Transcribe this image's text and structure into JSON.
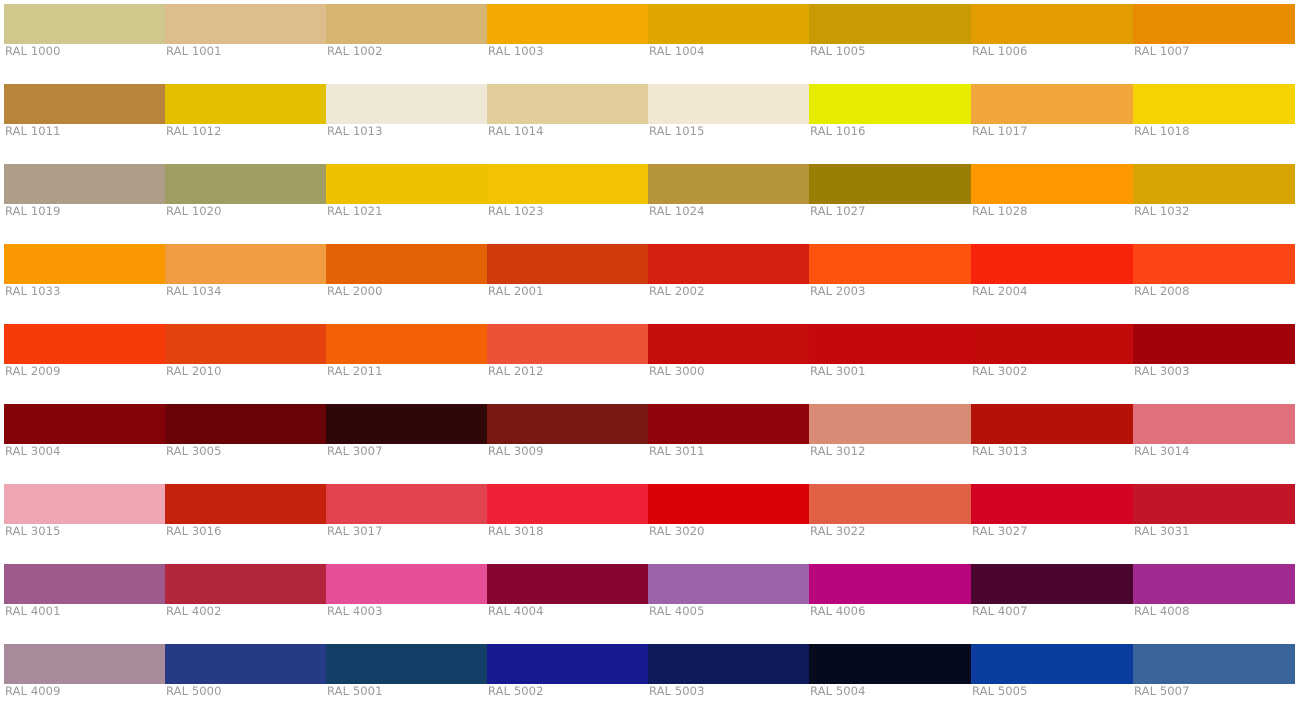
{
  "swatches": [
    {
      "label": "RAL 1000",
      "color": "#cfc88d"
    },
    {
      "label": "RAL 1001",
      "color": "#dcbd8b"
    },
    {
      "label": "RAL 1002",
      "color": "#d7b46f"
    },
    {
      "label": "RAL 1003",
      "color": "#f2a901"
    },
    {
      "label": "RAL 1004",
      "color": "#e0a600"
    },
    {
      "label": "RAL 1005",
      "color": "#c99a04"
    },
    {
      "label": "RAL 1006",
      "color": "#e39c01"
    },
    {
      "label": "RAL 1007",
      "color": "#e88b01"
    },
    {
      "label": "RAL 1011",
      "color": "#b8843c"
    },
    {
      "label": "RAL 1012",
      "color": "#e2c000"
    },
    {
      "label": "RAL 1013",
      "color": "#f0e8d6"
    },
    {
      "label": "RAL 1014",
      "color": "#e2cd9c"
    },
    {
      "label": "RAL 1015",
      "color": "#f1e7d3"
    },
    {
      "label": "RAL 1016",
      "color": "#e6eb00"
    },
    {
      "label": "RAL 1017",
      "color": "#f1a63c"
    },
    {
      "label": "RAL 1018",
      "color": "#f6d300"
    },
    {
      "label": "RAL 1019",
      "color": "#ae9d88"
    },
    {
      "label": "RAL 1020",
      "color": "#a09d63"
    },
    {
      "label": "RAL 1021",
      "color": "#edc000"
    },
    {
      "label": "RAL 1023",
      "color": "#f3c200"
    },
    {
      "label": "RAL 1024",
      "color": "#b69539"
    },
    {
      "label": "RAL 1027",
      "color": "#9a7e05"
    },
    {
      "label": "RAL 1028",
      "color": "#fd9800"
    },
    {
      "label": "RAL 1032",
      "color": "#d8a401"
    },
    {
      "label": "RAL 1033",
      "color": "#f99800"
    },
    {
      "label": "RAL 1034",
      "color": "#f09d41"
    },
    {
      "label": "RAL 2000",
      "color": "#e36304"
    },
    {
      "label": "RAL 2001",
      "color": "#cf3b0d"
    },
    {
      "label": "RAL 2002",
      "color": "#d6200f"
    },
    {
      "label": "RAL 2003",
      "color": "#fd530f"
    },
    {
      "label": "RAL 2004",
      "color": "#f7230a"
    },
    {
      "label": "RAL 2008",
      "color": "#fb4512"
    },
    {
      "label": "RAL 2009",
      "color": "#f33a07"
    },
    {
      "label": "RAL 2010",
      "color": "#e6420e"
    },
    {
      "label": "RAL 2011",
      "color": "#f26205"
    },
    {
      "label": "RAL 2012",
      "color": "#ec5236"
    },
    {
      "label": "RAL 3000",
      "color": "#c50d0c"
    },
    {
      "label": "RAL 3001",
      "color": "#c5080c"
    },
    {
      "label": "RAL 3002",
      "color": "#c30a0b"
    },
    {
      "label": "RAL 3003",
      "color": "#a2030a"
    },
    {
      "label": "RAL 3004",
      "color": "#840308"
    },
    {
      "label": "RAL 3005",
      "color": "#6a0308"
    },
    {
      "label": "RAL 3007",
      "color": "#2f0708"
    },
    {
      "label": "RAL 3009",
      "color": "#771813"
    },
    {
      "label": "RAL 3011",
      "color": "#92040b"
    },
    {
      "label": "RAL 3012",
      "color": "#d98b76"
    },
    {
      "label": "RAL 3013",
      "color": "#b41208"
    },
    {
      "label": "RAL 3014",
      "color": "#e0717c"
    },
    {
      "label": "RAL 3015",
      "color": "#efa5b2"
    },
    {
      "label": "RAL 3016",
      "color": "#c4220d"
    },
    {
      "label": "RAL 3017",
      "color": "#e3434f"
    },
    {
      "label": "RAL 3018",
      "color": "#ee2136"
    },
    {
      "label": "RAL 3020",
      "color": "#dc0007"
    },
    {
      "label": "RAL 3022",
      "color": "#e06143"
    },
    {
      "label": "RAL 3027",
      "color": "#d30323"
    },
    {
      "label": "RAL 3031",
      "color": "#c31528"
    },
    {
      "label": "RAL 4001",
      "color": "#9d5b8c"
    },
    {
      "label": "RAL 4002",
      "color": "#b2253b"
    },
    {
      "label": "RAL 4003",
      "color": "#e64f97"
    },
    {
      "label": "RAL 4004",
      "color": "#870630"
    },
    {
      "label": "RAL 4005",
      "color": "#9c63a9"
    },
    {
      "label": "RAL 4006",
      "color": "#b8067d"
    },
    {
      "label": "RAL 4007",
      "color": "#4b0630"
    },
    {
      "label": "RAL 4008",
      "color": "#a02a90"
    },
    {
      "label": "RAL 4009",
      "color": "#a78b9a"
    },
    {
      "label": "RAL 5000",
      "color": "#263a86"
    },
    {
      "label": "RAL 5001",
      "color": "#133e66"
    },
    {
      "label": "RAL 5002",
      "color": "#171a8f"
    },
    {
      "label": "RAL 5003",
      "color": "#0f1b58"
    },
    {
      "label": "RAL 5004",
      "color": "#060a1f"
    },
    {
      "label": "RAL 5005",
      "color": "#0b3d9e"
    },
    {
      "label": "RAL 5007",
      "color": "#3a6599"
    }
  ]
}
